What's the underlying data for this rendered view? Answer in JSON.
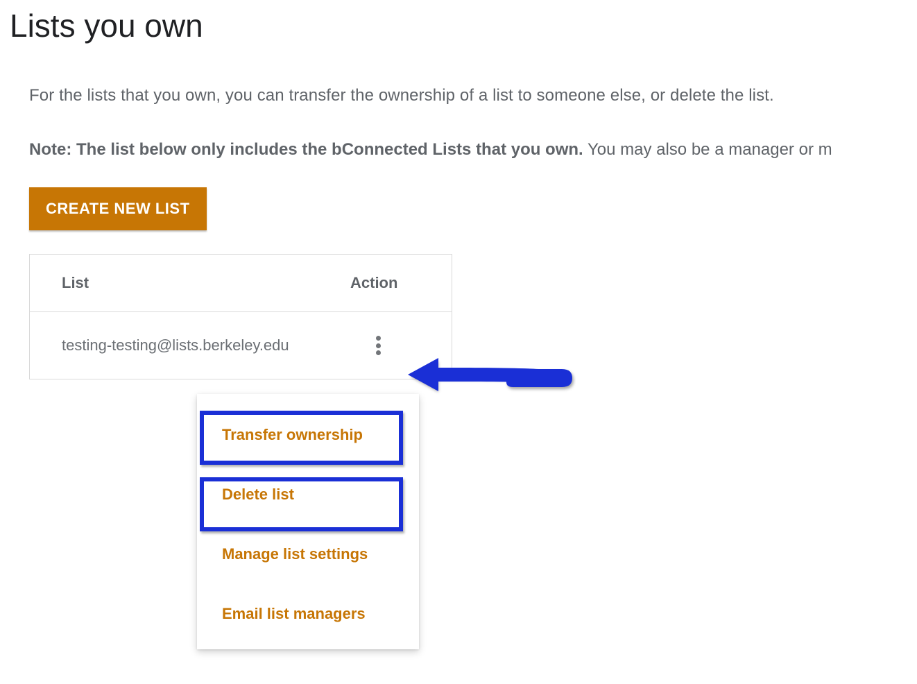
{
  "title": "Lists you own",
  "intro": "For the lists that you own, you can transfer the ownership of a list to someone else, or delete the list.",
  "note": {
    "bold": "Note: The list below only includes the bConnected Lists that you own.",
    "rest": " You may also be a manager or m"
  },
  "create_button": "CREATE NEW LIST",
  "table": {
    "headers": {
      "list": "List",
      "action": "Action"
    },
    "rows": [
      {
        "list": "testing-testing@lists.berkeley.edu"
      }
    ]
  },
  "menu": {
    "transfer": "Transfer ownership",
    "delete": "Delete list",
    "manage": "Manage list settings",
    "email": "Email list managers"
  },
  "colors": {
    "accent": "#c77605",
    "annotation": "#1a2fd6"
  }
}
